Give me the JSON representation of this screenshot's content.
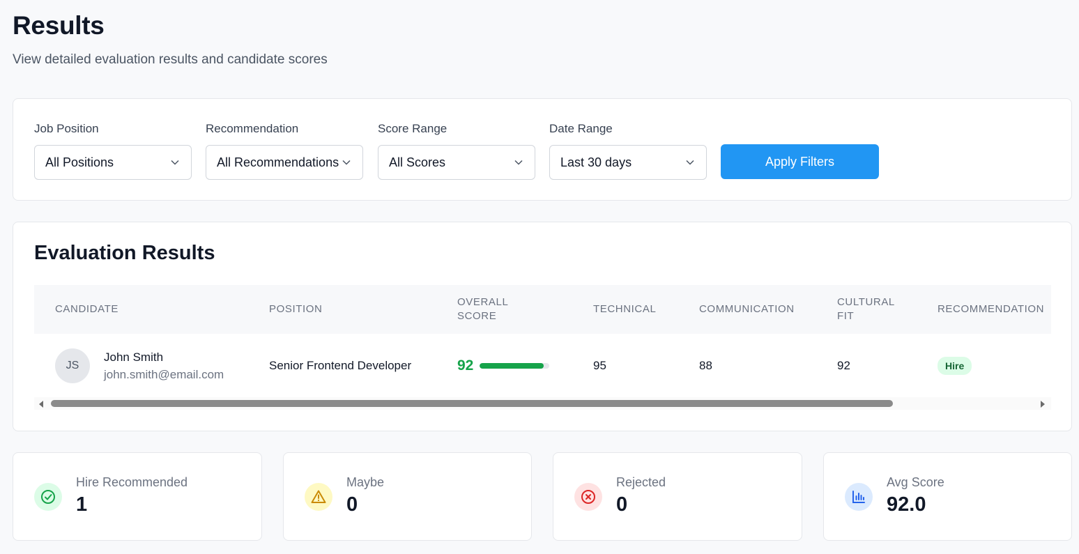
{
  "header": {
    "title": "Results",
    "subtitle": "View detailed evaluation results and candidate scores"
  },
  "filters": {
    "job_position": {
      "label": "Job Position",
      "value": "All Positions"
    },
    "recommendation": {
      "label": "Recommendation",
      "value": "All Recommendations"
    },
    "score_range": {
      "label": "Score Range",
      "value": "All Scores"
    },
    "date_range": {
      "label": "Date Range",
      "value": "Last 30 days"
    },
    "apply_label": "Apply Filters",
    "apply_color": "#2196f3"
  },
  "results": {
    "title": "Evaluation Results",
    "columns": {
      "candidate": "CANDIDATE",
      "position": "POSITION",
      "overall": "OVERALL SCORE",
      "technical": "TECHNICAL",
      "communication": "COMMUNICATION",
      "cultural": "CULTURAL FIT",
      "recommendation": "RECOMMENDATION"
    },
    "rows": [
      {
        "initials": "JS",
        "name": "John Smith",
        "email": "john.smith@email.com",
        "position": "Senior Frontend Developer",
        "overall": "92",
        "overall_fraction": 0.92,
        "technical": "95",
        "communication": "88",
        "cultural": "92",
        "recommendation": "Hire"
      }
    ]
  },
  "stats": {
    "hire": {
      "label": "Hire Recommended",
      "value": "1",
      "icon": "check-circle-icon",
      "color": "#16a34a"
    },
    "maybe": {
      "label": "Maybe",
      "value": "0",
      "icon": "warning-triangle-icon",
      "color": "#ca8a04"
    },
    "rejected": {
      "label": "Rejected",
      "value": "0",
      "icon": "x-circle-icon",
      "color": "#dc2626"
    },
    "avg": {
      "label": "Avg Score",
      "value": "92.0",
      "icon": "bar-chart-icon",
      "color": "#2563eb"
    }
  }
}
